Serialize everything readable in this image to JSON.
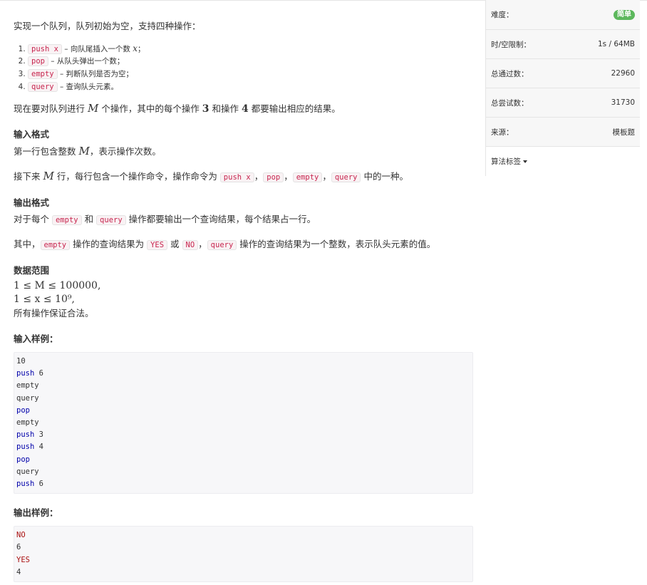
{
  "problem": {
    "intro": "实现一个队列，队列初始为空，支持四种操作：",
    "operations": [
      {
        "code": "push x",
        "desc_before": " – 向队尾插入一个数 ",
        "math": "x",
        "desc_after": "；"
      },
      {
        "code": "pop",
        "desc_before": " – 从队头弹出一个数；",
        "math": "",
        "desc_after": ""
      },
      {
        "code": "empty",
        "desc_before": " – 判断队列是否为空；",
        "math": "",
        "desc_after": ""
      },
      {
        "code": "query",
        "desc_before": " – 查询队头元素。",
        "math": "",
        "desc_after": ""
      }
    ],
    "task": {
      "t1": "现在要对队列进行 ",
      "m": "M",
      "t2": " 个操作，其中的每个操作 ",
      "n3": "3",
      "t3": " 和操作 ",
      "n4": "4",
      "t4": " 都要输出相应的结果。"
    },
    "input_format": {
      "title": "输入格式",
      "line1_a": "第一行包含整数 ",
      "line1_m": "M",
      "line1_b": "，表示操作次数。",
      "line2_a": "接下来 ",
      "line2_m": "M",
      "line2_b": " 行，每行包含一个操作命令，操作命令为 ",
      "cmds": [
        "push x",
        "pop",
        "empty",
        "query"
      ],
      "sep": "，",
      "line2_c": " 中的一种。"
    },
    "output_format": {
      "title": "输出格式",
      "l1_a": "对于每个 ",
      "l1_c1": "empty",
      "l1_b": " 和 ",
      "l1_c2": "query",
      "l1_c": " 操作都要输出一个查询结果，每个结果占一行。",
      "l2_a": "其中，",
      "l2_c1": "empty",
      "l2_b": " 操作的查询结果为 ",
      "l2_c2": "YES",
      "l2_c": " 或 ",
      "l2_c3": "NO",
      "l2_d": "，",
      "l2_c4": "query",
      "l2_e": " 操作的查询结果为一个整数，表示队头元素的值。"
    },
    "range": {
      "title": "数据范围",
      "r1": "1 ≤ M ≤ 100000,",
      "r2": "1 ≤ x ≤ 10⁹,",
      "r3": "所有操作保证合法。"
    },
    "sample_input": {
      "title": "输入样例：",
      "lines": [
        "10",
        "push 6",
        "empty",
        "query",
        "pop",
        "empty",
        "push 3",
        "push 4",
        "pop",
        "query",
        "push 6"
      ]
    },
    "sample_output": {
      "title": "输出样例：",
      "lines": [
        "NO",
        "6",
        "YES",
        "4"
      ]
    }
  },
  "sidebar": {
    "difficulty_label": "难度：",
    "difficulty_value": "简单",
    "limit_label": "时/空限制：",
    "limit_value": "1s / 64MB",
    "passed_label": "总通过数：",
    "passed_value": "22960",
    "tried_label": "总尝试数：",
    "tried_value": "31730",
    "source_label": "来源：",
    "source_value": "模板题",
    "tags_label": "算法标签"
  },
  "colors": {
    "code_text": "#c7254e",
    "code_bg": "#f9f2f4",
    "badge_green": "#5cb85c",
    "sample_keyword": "#0000aa",
    "sample_string": "#a11111"
  }
}
